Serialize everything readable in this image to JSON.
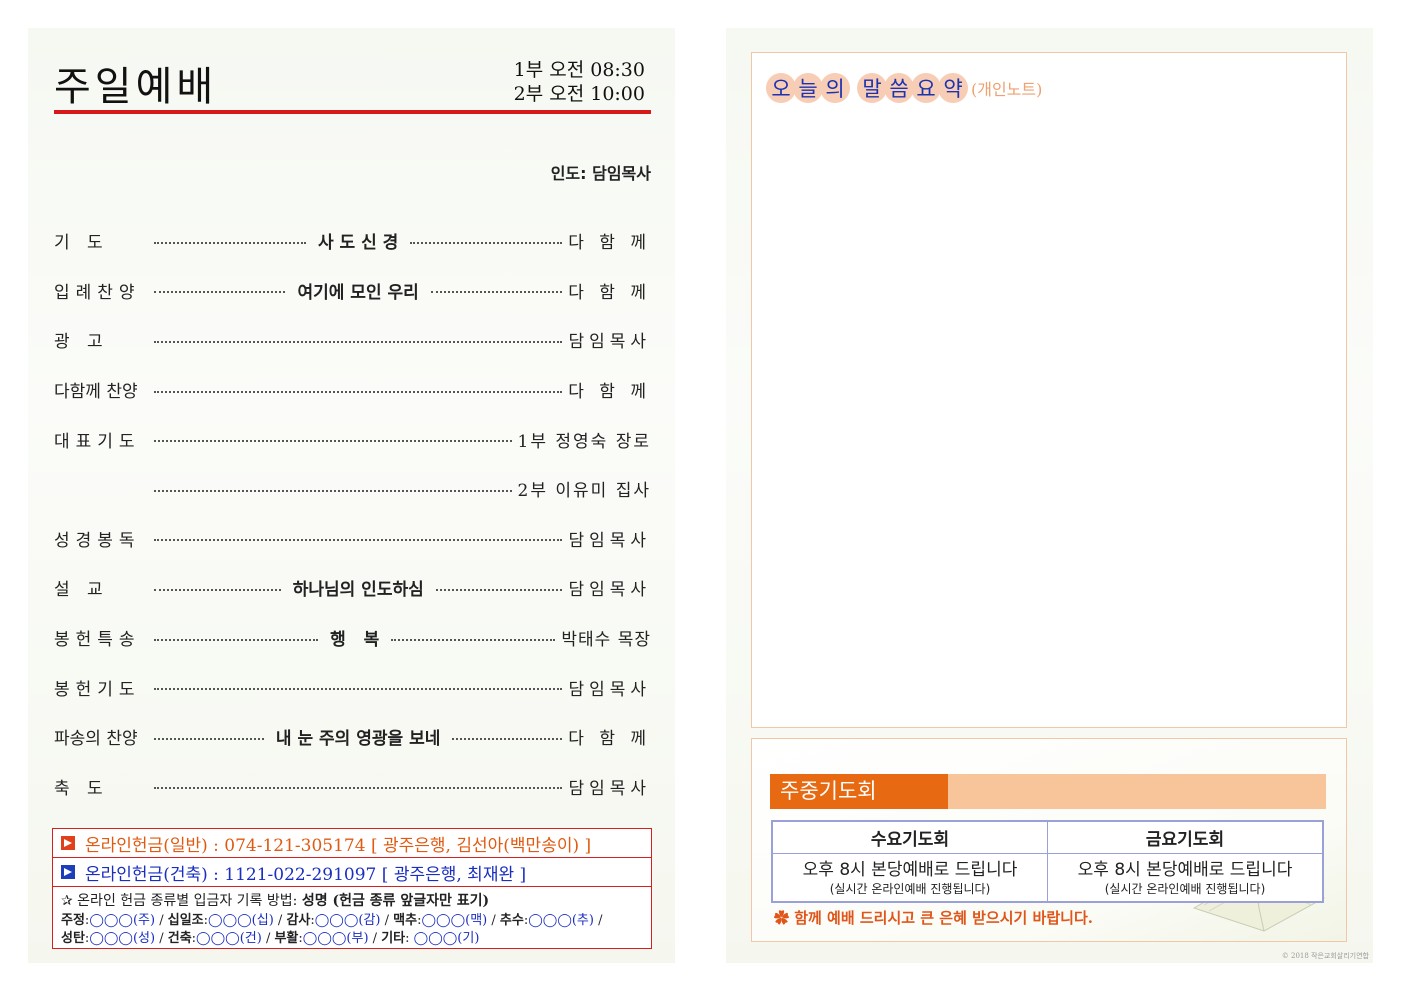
{
  "left": {
    "title": "주일예배",
    "service_time_1": "1부 오전 08:30",
    "service_time_2": "2부 오전 10:00",
    "leader": "인도: 담임목사",
    "order": [
      {
        "label": "기   도",
        "middle": "사 도 신 경",
        "who": "다 함 께"
      },
      {
        "label": "입례찬양",
        "middle": "여기에 모인 우리",
        "who": "다 함 께"
      },
      {
        "label": "광   고",
        "middle": "",
        "who": "담임목사"
      },
      {
        "label": "다함께 찬양",
        "middle": "",
        "who": "다 함 께"
      },
      {
        "label": "대표기도",
        "middle": "",
        "who": "1부 정영숙 장로"
      },
      {
        "label": "",
        "middle": "",
        "who": "2부 이유미 집사"
      },
      {
        "label": "성경봉독",
        "middle": "",
        "who": "담임목사"
      },
      {
        "label": "설   교",
        "middle": "하나님의 인도하심",
        "who": "담임목사"
      },
      {
        "label": "봉헌특송",
        "middle": "행   복",
        "who": "박태수 목장"
      },
      {
        "label": "봉헌기도",
        "middle": "",
        "who": "담임목사"
      },
      {
        "label": "파송의 찬양",
        "middle": "내 눈 주의 영광을 보네",
        "who": "다 함 께"
      },
      {
        "label": "축   도",
        "middle": "",
        "who": "담임목사"
      }
    ],
    "offering": {
      "general": "온라인헌금(일반) : 074-121-305174 [ 광주은행, 김선아(백만송이) ]",
      "building": "온라인헌금(건축) : 1121-022-291097 [ 광주은행, 최재완 ]",
      "method_prefix": "✰ 온라인 헌금 종류별 입금자 기록 방법: ",
      "method_bold": "성명 (헌금 종류 앞글자만 표기)",
      "legend_line1": [
        {
          "k": "주정",
          "v": "◯◯◯(주)"
        },
        {
          "k": "십일조",
          "v": "◯◯◯(십)"
        },
        {
          "k": "감사",
          "v": "◯◯◯(감)"
        },
        {
          "k": "맥추",
          "v": "◯◯◯(맥)"
        },
        {
          "k": "추수",
          "v": "◯◯◯(추)"
        }
      ],
      "legend_line2": [
        {
          "k": "성탄",
          "v": "◯◯◯(성)"
        },
        {
          "k": "건축",
          "v": "◯◯◯(건)"
        },
        {
          "k": "부활",
          "v": "◯◯◯(부)"
        },
        {
          "k": "기타",
          "v": "◯◯◯(기)"
        }
      ]
    }
  },
  "right": {
    "note_title_chars": [
      "오",
      "늘",
      "의",
      "말",
      "씀",
      "요",
      "약"
    ],
    "note_subtitle": "(개인노트)",
    "prayer": {
      "heading": "주중기도회",
      "wed_title": "수요기도회",
      "fri_title": "금요기도회",
      "wed_main": "오후 8시 본당예배로 드립니다",
      "wed_sub": "(실시간 온라인예배 진행됩니다)",
      "fri_main": "오후 8시 본당예배로 드립니다",
      "fri_sub": "(실시간 온라인예배 진행됩니다)"
    },
    "closing": "✿ 함께 예배 드리시고 큰 은혜 받으시기 바랍니다.",
    "copyright": "© 2018 작은교회살리기연합"
  }
}
